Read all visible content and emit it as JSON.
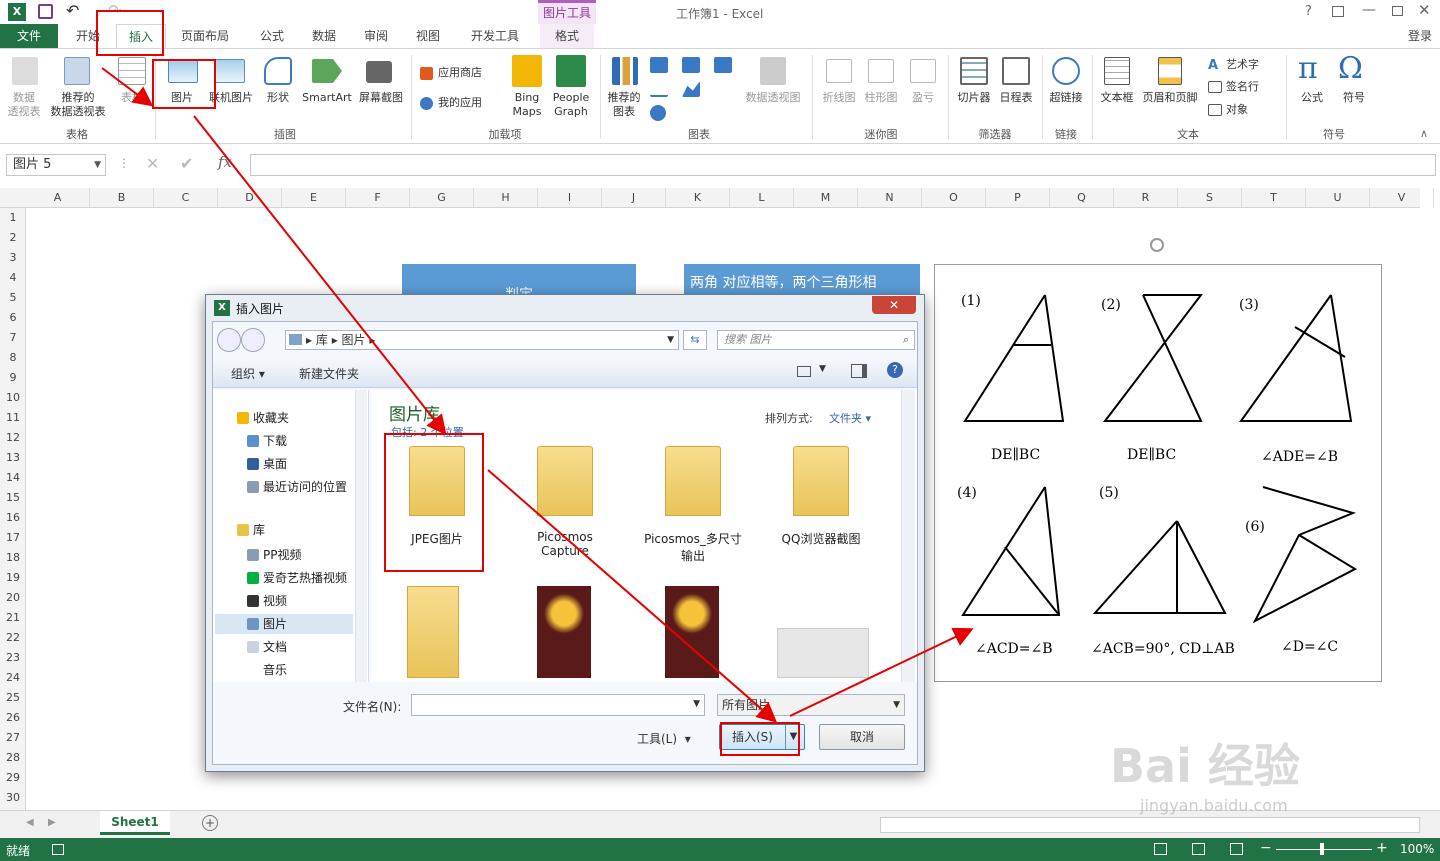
{
  "window": {
    "title": "工作簿1 - Excel",
    "picture_tools": "图片工具",
    "signin": "登录",
    "help": "?"
  },
  "tabs": [
    "文件",
    "开始",
    "插入",
    "页面布局",
    "公式",
    "数据",
    "审阅",
    "视图",
    "开发工具",
    "格式"
  ],
  "ribbon": {
    "pivot": "数据\n透视表",
    "recommended_pivot": "推荐的\n数据透视表",
    "table": "表格",
    "picture": "图片",
    "online_picture": "联机图片",
    "shapes": "形状",
    "smartart": "SmartArt",
    "screenshot": "屏幕截图",
    "app_store": "应用商店",
    "my_apps": "我的应用",
    "bing_maps": "Bing\nMaps",
    "people_graph": "People\nGraph",
    "recommended_charts": "推荐的\n图表",
    "pivot_chart": "数据透视图",
    "line": "折线图",
    "column": "柱形图",
    "winloss": "盈亏",
    "slicer": "切片器",
    "timeline": "日程表",
    "hyperlink": "超链接",
    "textbox": "文本框",
    "header_footer": "页眉和页脚",
    "wordart": "艺术字",
    "signature": "签名行",
    "object": "对象",
    "equation": "公式",
    "symbol": "符号",
    "groups": [
      "表格",
      "插图",
      "加载项",
      "图表",
      "迷你图",
      "筛选器",
      "链接",
      "文本",
      "符号"
    ]
  },
  "formula_bar": {
    "name_box": "图片 5",
    "fx": "fx",
    "value": ""
  },
  "columns": [
    "A",
    "B",
    "C",
    "D",
    "E",
    "F",
    "G",
    "H",
    "I",
    "J",
    "K",
    "L",
    "M",
    "N",
    "O",
    "P",
    "Q",
    "R",
    "S",
    "T",
    "U",
    "V"
  ],
  "rows": [
    "1",
    "2",
    "3",
    "4",
    "5",
    "6",
    "7",
    "8",
    "9",
    "10",
    "11",
    "12",
    "13",
    "14",
    "15",
    "16",
    "17",
    "18",
    "19",
    "20",
    "21",
    "22",
    "23",
    "24",
    "25",
    "26",
    "27",
    "28",
    "29",
    "30"
  ],
  "sheet": {
    "banner1": "判定",
    "banner2": "两角 对应相等，两个三角形相"
  },
  "figure": {
    "labels": [
      "(1)",
      "(2)",
      "(3)",
      "(4)",
      "(5)",
      "(6)"
    ],
    "captions": [
      "DE∥BC",
      "DE∥BC",
      "∠ADE=∠B",
      "∠ACD=∠B",
      "∠ACB=90°, CD⊥AB",
      "∠D=∠C"
    ]
  },
  "dialog": {
    "title": "插入图片",
    "breadcrumb": [
      "库",
      "图片"
    ],
    "search_placeholder": "搜索 图片",
    "organize": "组织",
    "new_folder": "新建文件夹",
    "nav": {
      "favorites": "收藏夹",
      "fav_items": [
        "下载",
        "桌面",
        "最近访问的位置"
      ],
      "library": "库",
      "lib_items": [
        "PP视频",
        "爱奇艺热播视频",
        "视频",
        "图片",
        "文档",
        "音乐"
      ]
    },
    "library_title": "图片库",
    "library_sub": "包括: 2 个位置",
    "sort_label": "排列方式:",
    "sort_value": "文件夹",
    "folders": [
      "JPEG图片",
      "Picosmos Capture",
      "Picosmos_多尺寸输出",
      "QQ浏览器截图"
    ],
    "filename_label": "文件名(N):",
    "filename_value": "",
    "filter_value": "所有图片",
    "tools": "工具(L)",
    "insert": "插入(S)",
    "cancel": "取消"
  },
  "sheet_tab": "Sheet1",
  "status": {
    "ready": "就绪",
    "zoom": "100%"
  },
  "watermark": {
    "brand": "Bai 经验",
    "url": "jingyan.baidu.com"
  }
}
